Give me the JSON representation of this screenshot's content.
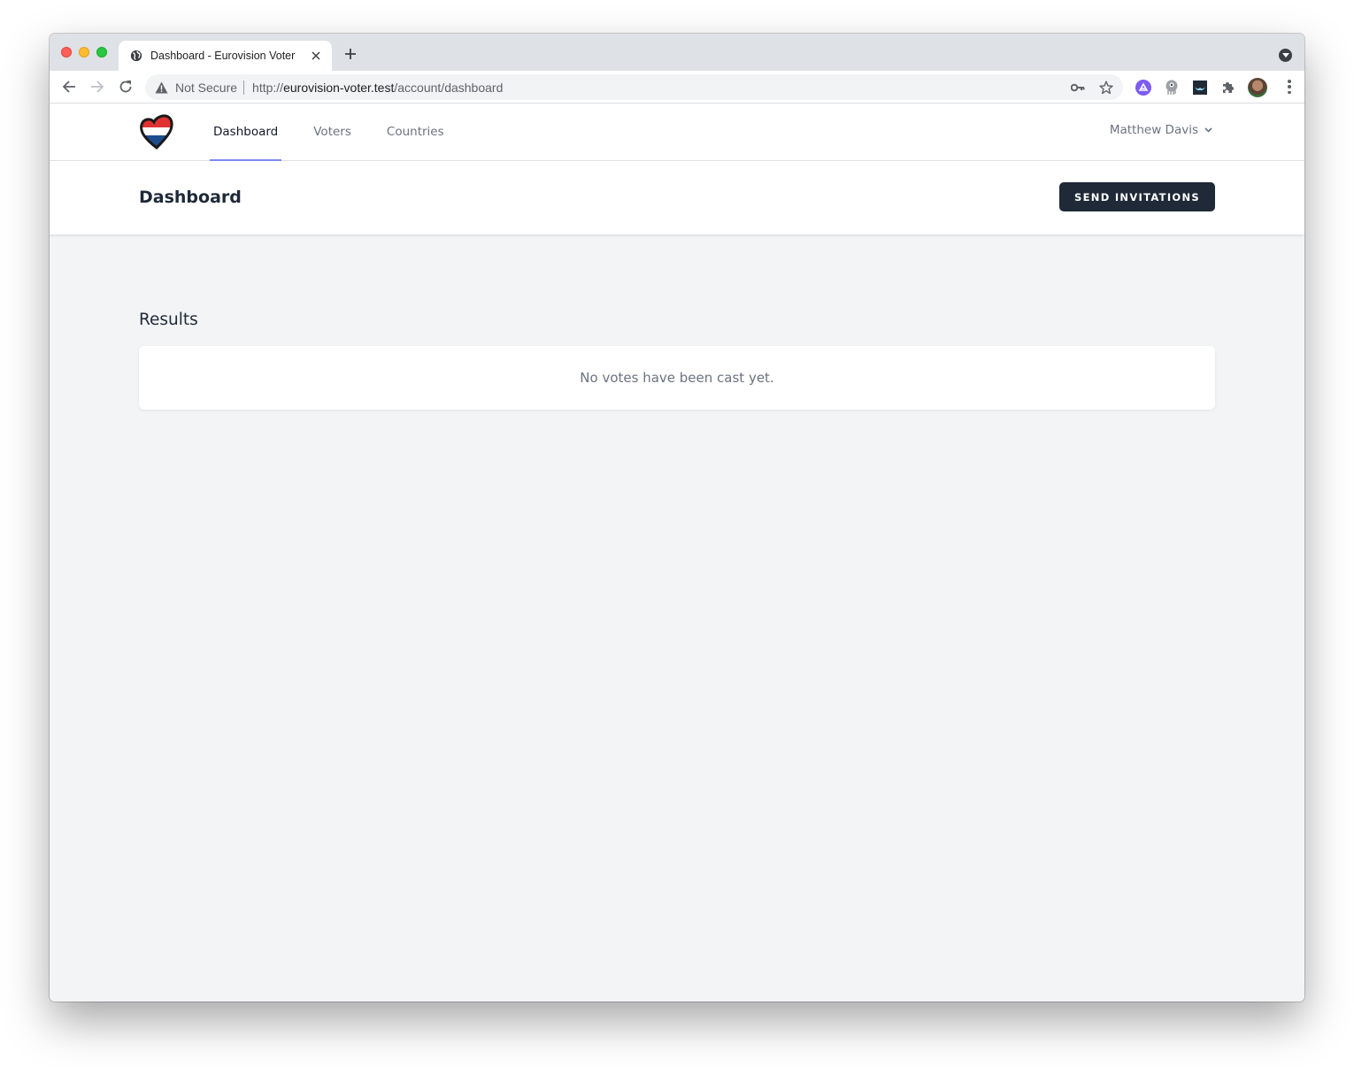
{
  "browser": {
    "tab": {
      "title": "Dashboard - Eurovision Voter",
      "favicon": "globe-icon",
      "close_icon": "close-icon"
    },
    "new_tab_icon": "plus-icon",
    "tab_search_icon": "chevron-down-circle-icon",
    "toolbar": {
      "back_icon": "arrow-left-icon",
      "forward_icon": "arrow-right-icon",
      "reload_icon": "reload-icon",
      "security_icon": "warning-triangle-icon",
      "security_label": "Not Secure",
      "url_scheme": "http://",
      "url_host": "eurovision-voter.test",
      "url_path": "/account/dashboard",
      "omnibox_icons": [
        "key-icon",
        "star-icon"
      ],
      "extensions": [
        "extension-purple-icon",
        "extension-alien-icon",
        "extension-dark-icon",
        "puzzle-icon"
      ],
      "profile": "avatar",
      "menu_icon": "kebab-menu-icon"
    }
  },
  "app": {
    "logo": "eurovision-heart-logo",
    "logo_colors": {
      "red": "#e03131",
      "white": "#ffffff",
      "blue": "#1c4e8f"
    },
    "nav": {
      "items": [
        {
          "label": "Dashboard",
          "active": true
        },
        {
          "label": "Voters",
          "active": false
        },
        {
          "label": "Countries",
          "active": false
        }
      ],
      "active_indicator_color": "#818cf8"
    },
    "user_menu": {
      "name": "Matthew Davis",
      "icon": "chevron-down-icon"
    },
    "header": {
      "title": "Dashboard",
      "primary_button": "SEND INVITATIONS",
      "primary_button_color": "#1f2937"
    },
    "results": {
      "title": "Results",
      "empty_message": "No votes have been cast yet."
    }
  }
}
